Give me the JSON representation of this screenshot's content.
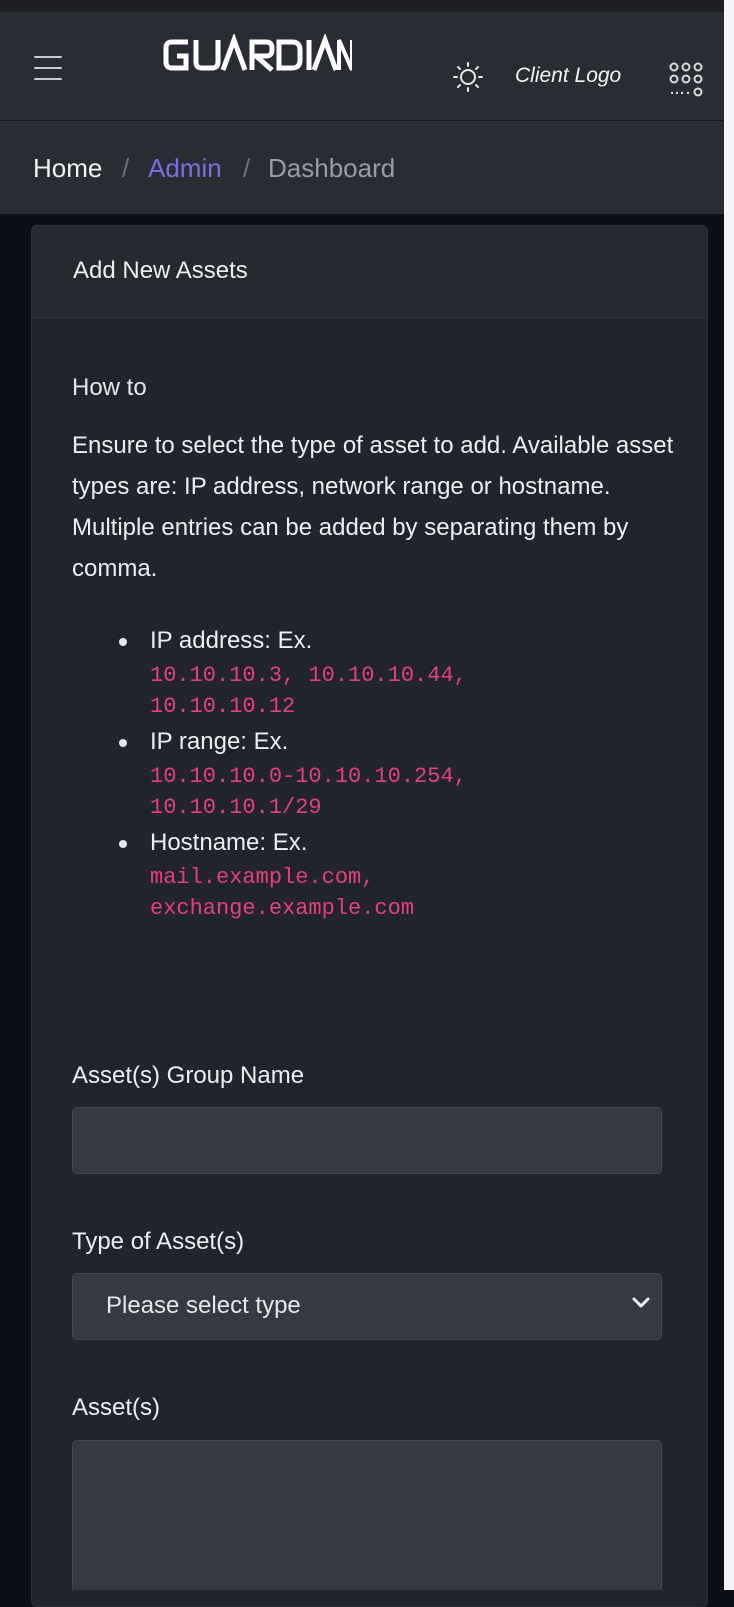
{
  "header": {
    "brand": "GUARDIAN",
    "client_logo": "Client Logo",
    "icons": [
      "hamburger-menu-icon",
      "sun-icon",
      "apps-grid-icon"
    ]
  },
  "breadcrumb": {
    "home": "Home",
    "admin": "Admin",
    "current": "Dashboard",
    "separator": "/"
  },
  "card": {
    "title": "Add New Assets",
    "howto_heading": "How to",
    "description": "Ensure to select the type of asset to add. Available asset types are: IP address, network range or hostname. Multiple entries can be added by separating them by comma.",
    "examples": [
      {
        "label": "IP address: Ex.",
        "lines": [
          "10.10.10.3, 10.10.10.44,",
          "10.10.10.12"
        ]
      },
      {
        "label": "IP range: Ex.",
        "lines": [
          "10.10.10.0-10.10.10.254,",
          "10.10.10.1/29"
        ]
      },
      {
        "label": "Hostname: Ex.",
        "lines": [
          "mail.example.com,",
          "exchange.example.com"
        ]
      }
    ]
  },
  "form": {
    "group_name_label": "Asset(s) Group Name",
    "group_name_value": "",
    "type_label": "Type of Asset(s)",
    "type_selected": "Please select type",
    "assets_label": "Asset(s)",
    "assets_value": ""
  },
  "colors": {
    "background": "#0d0f17",
    "panel": "#2a2c34",
    "card": "#22242d",
    "accent_link": "#7b6fe0",
    "code": "#e4417c"
  }
}
